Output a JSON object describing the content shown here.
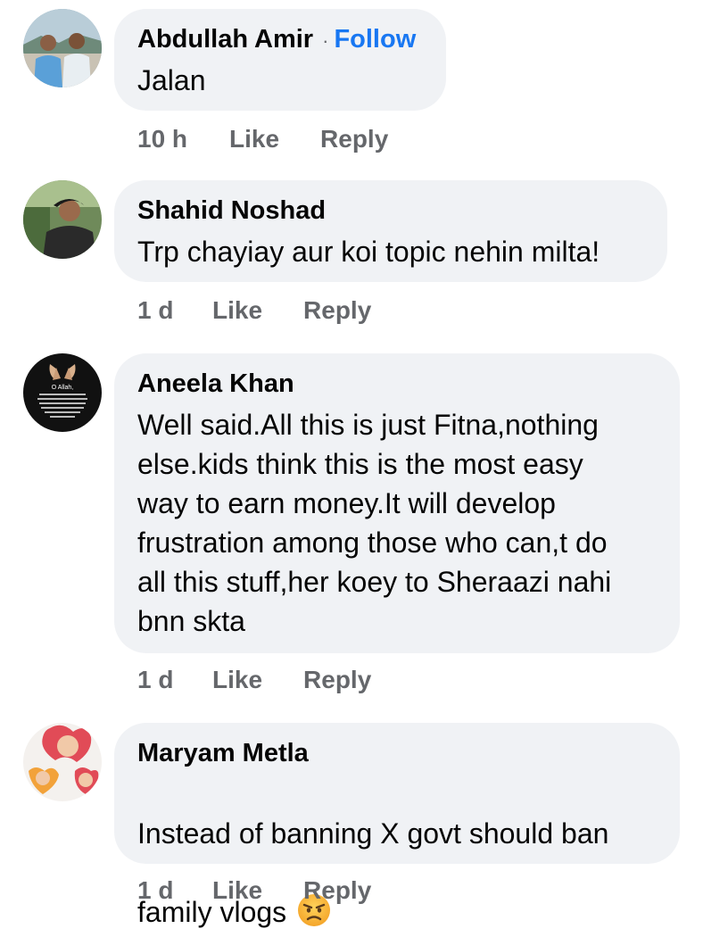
{
  "comments": [
    {
      "author": "Abdullah Amir",
      "follow": "Follow",
      "separator": "·",
      "text": "Jalan",
      "time": "10 h",
      "like": "Like",
      "reply": "Reply"
    },
    {
      "author": "Shahid Noshad",
      "text": "Trp chayiay aur koi topic nehin milta!",
      "time": "1 d",
      "like": "Like",
      "reply": "Reply"
    },
    {
      "author": "Aneela Khan",
      "text": "Well said.All this is just Fitna,nothing\nelse.kids think this is the most easy\nway to earn money.It will develop\nfrustration among those who can,t do\nall this stuff,her koey to Sheraazi nahi\nbnn skta",
      "time": "1 d",
      "like": "Like",
      "reply": "Reply",
      "avatar_text": "O Allah,"
    },
    {
      "author": "Maryam Metla",
      "text_line1": "Instead of banning X govt should ban",
      "text_line2": "family vlogs",
      "emoji": "angry-face-emoji",
      "time": "1 d",
      "like": "Like",
      "reply": "Reply"
    }
  ],
  "colors": {
    "bubble": "#f0f2f5",
    "text": "#050505",
    "meta": "#65676b",
    "link": "#1877f2"
  }
}
